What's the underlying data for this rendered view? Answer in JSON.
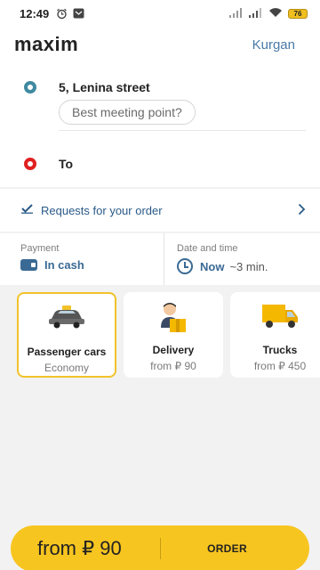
{
  "status_bar": {
    "time": "12:49",
    "battery": "76",
    "icons": [
      "alarm-icon",
      "message-icon",
      "signal-icon",
      "signal-icon",
      "wifi-icon",
      "battery-icon"
    ]
  },
  "header": {
    "logo": "maxim",
    "city": "Kurgan"
  },
  "route": {
    "from": "5, Lenina street",
    "meeting_point": "Best meeting point?",
    "to": "To"
  },
  "requests": {
    "label": "Requests for your order"
  },
  "payment": {
    "label": "Payment",
    "value": "In cash"
  },
  "datetime": {
    "label": "Date and time",
    "value": "Now",
    "eta": "~3 min."
  },
  "tariffs": [
    {
      "name": "Passenger cars",
      "price": "Economy",
      "icon": "taxi-car-icon",
      "selected": true
    },
    {
      "name": "Delivery",
      "price": "from ₽ 90",
      "icon": "courier-icon",
      "selected": false
    },
    {
      "name": "Trucks",
      "price": "from ₽ 450",
      "icon": "truck-icon",
      "selected": false
    }
  ],
  "order": {
    "amount": "from ₽ 90",
    "button": "ORDER"
  },
  "colors": {
    "brand_yellow": "#f7c520",
    "accent_blue": "#3a6a94",
    "from_pin": "#3f8aa0",
    "to_pin": "#e02020"
  }
}
